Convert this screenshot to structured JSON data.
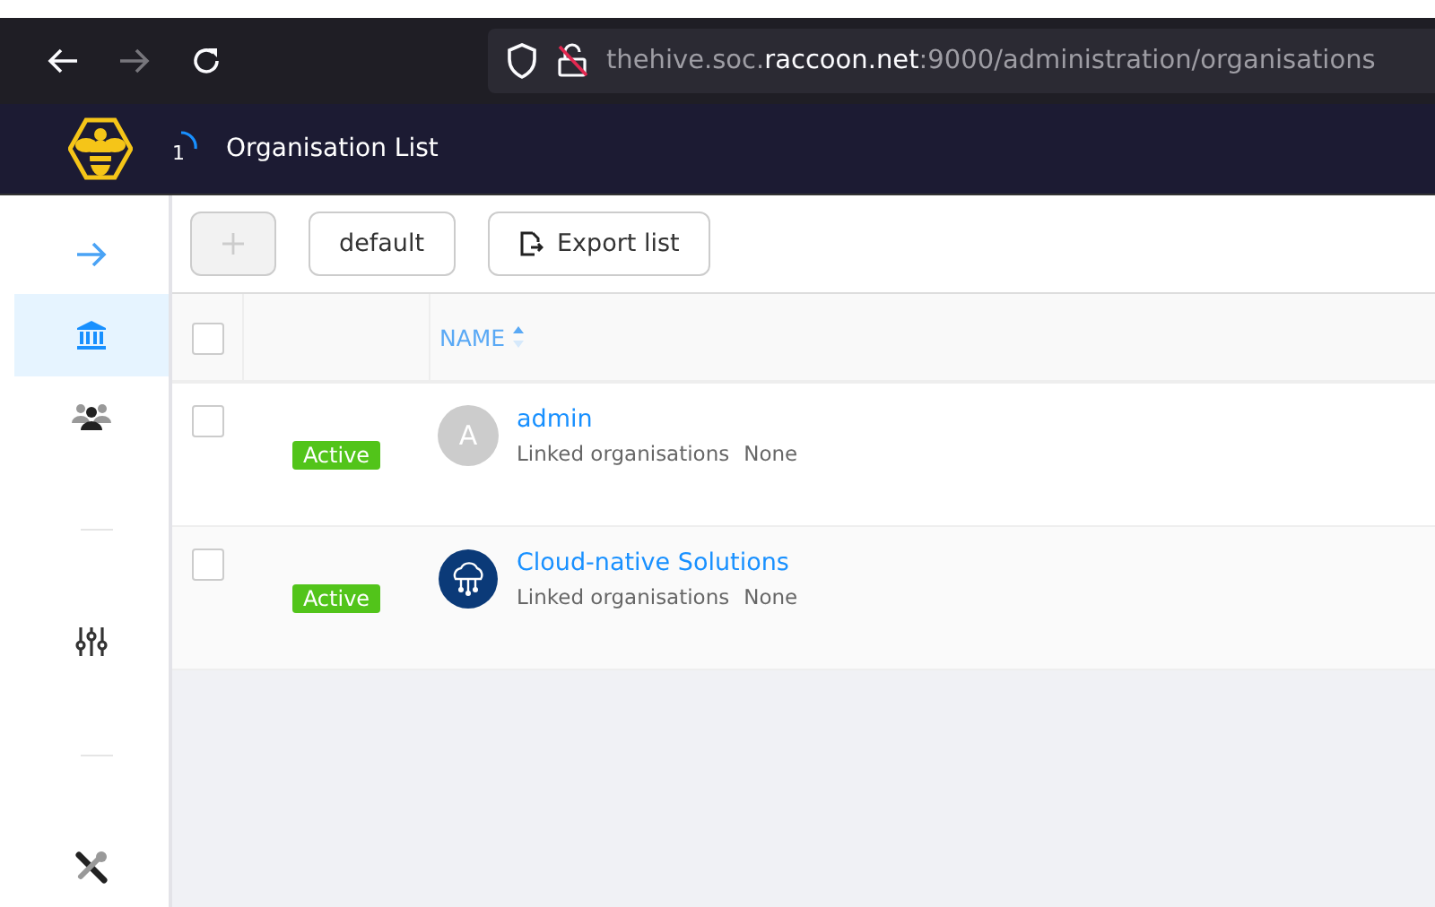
{
  "browser": {
    "url": {
      "host_start": "thehive.soc.",
      "host_domain": "raccoon.net",
      "path": ":9000/administration/organisations"
    }
  },
  "header": {
    "badge": "1",
    "title": "Organisation List"
  },
  "sidebar": {
    "items": [
      {
        "kind": "expand",
        "selected": false
      },
      {
        "kind": "organisations",
        "selected": true
      },
      {
        "kind": "users",
        "selected": false
      },
      {
        "kind": "divider"
      },
      {
        "kind": "settings",
        "selected": false
      },
      {
        "kind": "divider"
      },
      {
        "kind": "tools",
        "selected": false
      }
    ]
  },
  "toolbar": {
    "add_disabled": true,
    "buttons": [
      {
        "label": "default",
        "kind": "plain"
      },
      {
        "label": "Export list",
        "kind": "export"
      }
    ]
  },
  "table": {
    "select_all": false,
    "columns": [
      {
        "label": "NAME",
        "sorted": true
      }
    ],
    "rows": [
      {
        "checked": false,
        "status": "Active",
        "kind": "letter",
        "avatar_text": "A",
        "name": "admin",
        "linked_label": "Linked organisations",
        "linked_value": "None"
      },
      {
        "checked": false,
        "status": "Active",
        "kind": "logo",
        "name": "Cloud-native Solutions",
        "linked_label": "Linked organisations",
        "linked_value": "None"
      }
    ]
  }
}
